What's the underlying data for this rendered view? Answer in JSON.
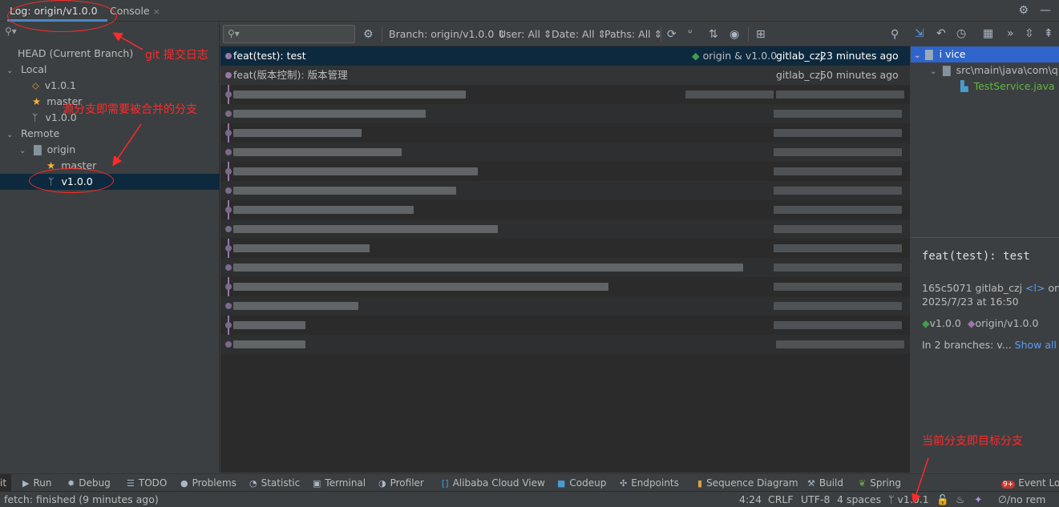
{
  "tabs": {
    "log_tab": "Log: origin/v1.0.0",
    "console_tab": "Console",
    "close_glyph": "×"
  },
  "branches": {
    "head": "HEAD (Current Branch)",
    "local": "Local",
    "local_tag": "v1.0.1",
    "local_master": "master",
    "local_branch": "v1.0.0",
    "remote": "Remote",
    "origin": "origin",
    "origin_master": "master",
    "origin_branch": "v1.0.0"
  },
  "toolbar": {
    "branch": "Branch: origin/v1.0.0 ⇕",
    "user": "User: All ⇕",
    "date": "Date: All ⇕",
    "paths": "Paths: All ⇕"
  },
  "commits": [
    {
      "message": "feat(test): test",
      "refs": "origin & v1.0.0",
      "author": "gitlab_czj",
      "time": "23 minutes ago"
    },
    {
      "message": "feat(版本控制): 版本管理",
      "refs": "",
      "author": "gitlab_czj",
      "time": "50 minutes ago"
    }
  ],
  "files": {
    "module": "i              vice",
    "path": "src\\main\\java\\com\\qi",
    "file": "TestService.java"
  },
  "details": {
    "title": "feat(test): test",
    "meta": "165c5071 gitlab_czj",
    "email": "<l>",
    "on": " on",
    "date": "2025/7/23 at 16:50",
    "tag1": "v1.0.0",
    "tag2": "origin/v1.0.0",
    "branches_text": "In 2 branches: v... ",
    "show_all": "Show all"
  },
  "tool_windows": {
    "git": "it",
    "run": "Run",
    "debug": "Debug",
    "todo": "TODO",
    "problems": "Problems",
    "statistic": "Statistic",
    "terminal": "Terminal",
    "profiler": "Profiler",
    "alibaba": "Alibaba Cloud View",
    "codeup": "Codeup",
    "endpoints": "Endpoints",
    "sequence": "Sequence Diagram",
    "build": "Build",
    "spring": "Spring",
    "event_badge": "9+",
    "event_log": "Event Log"
  },
  "status": {
    "fetch": "fetch: finished (9 minutes ago)",
    "position": "4:24",
    "line_sep": "CRLF",
    "encoding": "UTF-8",
    "indent": "4 spaces",
    "branch": "v1.0.1",
    "remote": "∅/no rem"
  },
  "annotations": {
    "git_log": "git 提交日志",
    "source_branch": "源分支即需要被合并的分支",
    "target_branch": "当前分支即目标分支"
  },
  "colors": {
    "background": "#3c3f41",
    "log_background": "#2b2b2b",
    "selection": "#0d293e",
    "annotation": "#ff2a2a",
    "graph": "#9876aa",
    "link": "#589df6"
  }
}
